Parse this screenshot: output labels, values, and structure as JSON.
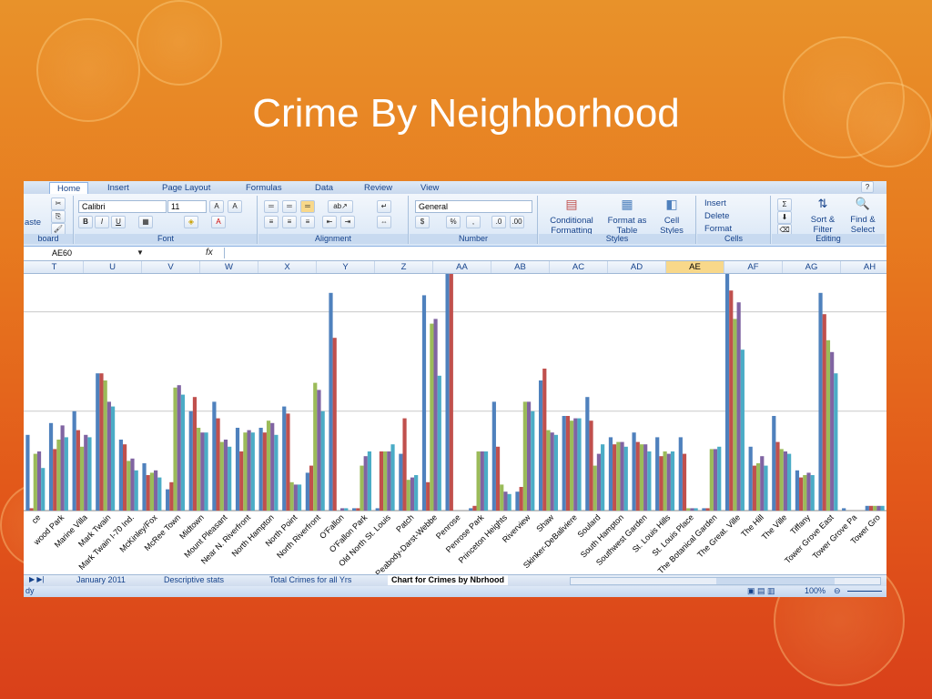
{
  "slide": {
    "title": "Crime By Neighborhood"
  },
  "ribbon": {
    "tabs": [
      "Home",
      "Insert",
      "Page Layout",
      "Formulas",
      "Data",
      "Review",
      "View"
    ],
    "clipboard": {
      "paste": "aste",
      "label": "board"
    },
    "font": {
      "name": "Calibri",
      "size": "11",
      "label": "Font"
    },
    "alignment": {
      "label": "Alignment"
    },
    "number": {
      "format": "General",
      "label": "Number",
      "currency": "$",
      "percent": "%",
      "comma": ","
    },
    "styles": {
      "label": "Styles",
      "conditional": "Conditional Formatting",
      "format_table": "Format as Table",
      "cell_styles": "Cell Styles"
    },
    "cells": {
      "label": "Cells",
      "insert": "Insert",
      "delete": "Delete",
      "format": "Format"
    },
    "editing": {
      "label": "Editing",
      "sort": "Sort & Filter",
      "find": "Find & Select"
    }
  },
  "formula_bar": {
    "name_box": "AE60",
    "fx": "fx"
  },
  "columns": [
    "T",
    "U",
    "V",
    "W",
    "X",
    "Y",
    "Z",
    "AA",
    "AB",
    "AC",
    "AD",
    "AE",
    "AF",
    "AG",
    "AH"
  ],
  "selected_column": "AE",
  "sheet_tabs": [
    "January 2011",
    "Descriptive stats",
    "Total Crimes for all Yrs",
    "Chart for Crimes by Nbrhood"
  ],
  "active_sheet": "Chart for Crimes by Nbrhood",
  "status": {
    "left": "dy",
    "zoom": "100%"
  },
  "colors": {
    "series": [
      "#4f81bd",
      "#c0504d",
      "#9bbb59",
      "#8064a2",
      "#4bacc6"
    ],
    "accent": "#e77a1f"
  },
  "chart_data": {
    "type": "bar",
    "title": "",
    "xlabel": "",
    "ylabel": "",
    "ylim": [
      0,
      100
    ],
    "grid": true,
    "categories": [
      "ce",
      "wood Park",
      "Marine Villa",
      "Mark Twain",
      "Mark Twain I-70 Ind.",
      "McKinley/Fox",
      "McRee Town",
      "Midtown",
      "Mount Pleasant",
      "Near N. Riverfront",
      "North Hampton",
      "North Point",
      "North Riverfront",
      "O'Fallon",
      "O'Fallon Park",
      "Old North St. Louis",
      "Patch",
      "Peabody-Darst-Webbe",
      "Penrose",
      "Penrose Park",
      "Princeton Heights",
      "Riverview",
      "Shaw",
      "Skinker-DeBaliviere",
      "Soulard",
      "South Hampton",
      "Southwest Garden",
      "St. Louis Hills",
      "St. Louis Place",
      "The Botanical Garden",
      "The Great. Ville",
      "The Hill",
      "The Ville",
      "Tiffany",
      "Tower Grove East",
      "Tower Grove Pa",
      "Tower Gro"
    ],
    "series": [
      {
        "values": [
          32,
          37,
          42,
          58,
          30,
          20,
          9,
          42,
          46,
          35,
          35,
          44,
          16,
          92,
          1,
          1,
          24,
          91,
          100,
          1,
          46,
          8,
          55,
          40,
          48,
          31,
          33,
          31,
          31,
          1,
          100,
          27,
          40,
          17,
          92,
          1,
          2
        ]
      },
      {
        "values": [
          1,
          26,
          34,
          58,
          28,
          15,
          12,
          48,
          39,
          25,
          33,
          41,
          19,
          73,
          1,
          25,
          39,
          12,
          100,
          2,
          27,
          10,
          60,
          40,
          38,
          28,
          29,
          23,
          24,
          1,
          93,
          19,
          29,
          14,
          83,
          0,
          2
        ]
      },
      {
        "values": [
          24,
          30,
          27,
          55,
          21,
          16,
          52,
          35,
          29,
          33,
          38,
          12,
          54,
          0,
          19,
          25,
          13,
          79,
          0,
          25,
          11,
          46,
          34,
          38,
          19,
          29,
          28,
          25,
          1,
          26,
          81,
          20,
          26,
          15,
          72,
          0,
          2
        ]
      },
      {
        "values": [
          25,
          36,
          32,
          46,
          22,
          17,
          53,
          33,
          30,
          34,
          37,
          11,
          51,
          1,
          23,
          25,
          14,
          81,
          0,
          25,
          8,
          46,
          33,
          39,
          24,
          29,
          28,
          24,
          1,
          26,
          88,
          23,
          25,
          16,
          67,
          0,
          2
        ]
      },
      {
        "values": [
          18,
          31,
          31,
          44,
          17,
          14,
          49,
          33,
          27,
          33,
          32,
          11,
          42,
          1,
          25,
          28,
          15,
          57,
          0,
          25,
          7,
          42,
          32,
          39,
          28,
          27,
          25,
          25,
          1,
          27,
          68,
          19,
          24,
          15,
          58,
          0,
          2
        ]
      }
    ]
  }
}
